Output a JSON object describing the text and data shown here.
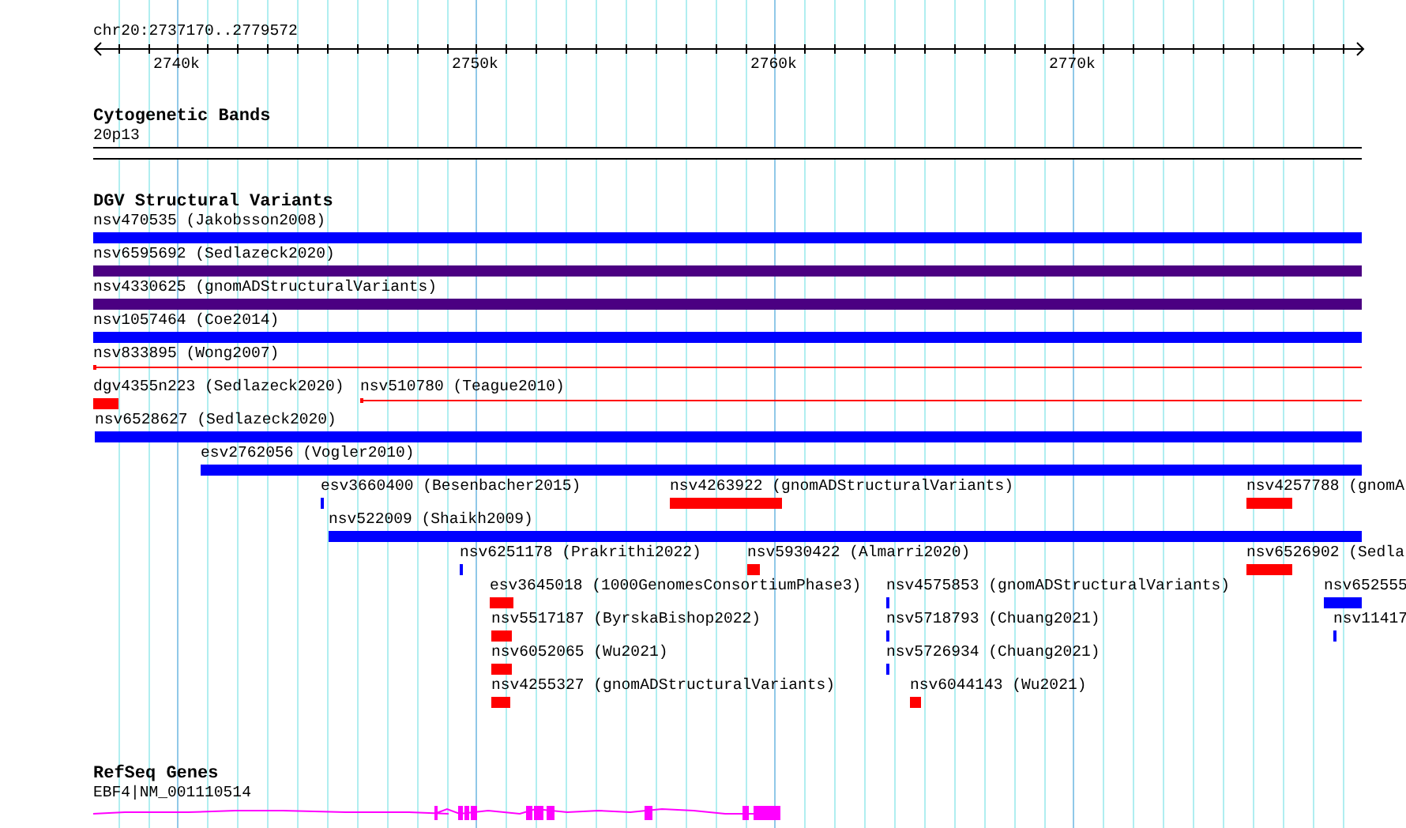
{
  "location": "chr20:2737170..2779572",
  "ruler": {
    "ticks": [
      "2740k",
      "2750k",
      "2760k",
      "2770k"
    ]
  },
  "tracks": [
    {
      "kind": "bands",
      "title": "Cytogenetic Bands",
      "label": "20p13"
    },
    {
      "kind": "variants",
      "title": "DGV Structural Variants",
      "rows": [
        {
          "features": [
            {
              "label": "nsv470535 (Jakobsson2008)",
              "kind": "bar",
              "color": "#0000ff"
            }
          ]
        },
        {
          "features": [
            {
              "label": "nsv6595692 (Sedlazeck2020)",
              "kind": "bar",
              "color": "#4b0082"
            }
          ]
        },
        {
          "features": [
            {
              "label": "nsv4330625 (gnomADStructuralVariants)",
              "kind": "bar",
              "color": "#4b0082"
            }
          ]
        },
        {
          "features": [
            {
              "label": "nsv1057464 (Coe2014)",
              "kind": "bar",
              "color": "#0000ff"
            }
          ]
        },
        {
          "features": [
            {
              "label": "nsv833895 (Wong2007)",
              "kind": "line",
              "color": "#ff0000"
            }
          ]
        },
        {
          "features": [
            {
              "label": "dgv4355n223 (Sedlazeck2020)",
              "kind": "bar",
              "color": "#ff0000"
            },
            {
              "label": "nsv510780 (Teague2010)",
              "kind": "line",
              "color": "#ff0000"
            }
          ]
        },
        {
          "features": [
            {
              "label": "nsv6528627 (Sedlazeck2020)",
              "kind": "bar",
              "color": "#0000ff"
            }
          ]
        },
        {
          "features": [
            {
              "label": "esv2762056 (Vogler2010)",
              "kind": "bar",
              "color": "#0000ff"
            }
          ]
        },
        {
          "features": [
            {
              "label": "esv3660400 (Besenbacher2015)",
              "kind": "bar",
              "color": "#0000ff"
            },
            {
              "label": "nsv4263922 (gnomADStructuralVariants)",
              "kind": "bar",
              "color": "#ff0000"
            },
            {
              "label": "nsv4257788 (gnomA",
              "kind": "bar",
              "color": "#ff0000"
            }
          ]
        },
        {
          "features": [
            {
              "label": "nsv522009 (Shaikh2009)",
              "kind": "bar",
              "color": "#0000ff"
            }
          ]
        },
        {
          "features": [
            {
              "label": "nsv6251178 (Prakrithi2022)",
              "kind": "bar",
              "color": "#0000ff"
            },
            {
              "label": "nsv5930422 (Almarri2020)",
              "kind": "bar",
              "color": "#ff0000"
            },
            {
              "label": "nsv6526902 (Sedla",
              "kind": "bar",
              "color": "#ff0000"
            }
          ]
        },
        {
          "features": [
            {
              "label": "esv3645018 (1000GenomesConsortiumPhase3)",
              "kind": "bar",
              "color": "#ff0000"
            },
            {
              "label": "nsv4575853 (gnomADStructuralVariants)",
              "kind": "bar",
              "color": "#0000ff"
            },
            {
              "label": "nsv652555",
              "kind": "bar",
              "color": "#0000ff"
            }
          ]
        },
        {
          "features": [
            {
              "label": "nsv5517187 (ByrskaBishop2022)",
              "kind": "bar",
              "color": "#ff0000"
            },
            {
              "label": "nsv5718793 (Chuang2021)",
              "kind": "bar",
              "color": "#0000ff"
            },
            {
              "label": "nsv11417",
              "kind": "bar",
              "color": "#0000ff"
            }
          ]
        },
        {
          "features": [
            {
              "label": "nsv6052065 (Wu2021)",
              "kind": "bar",
              "color": "#ff0000"
            },
            {
              "label": "nsv5726934 (Chuang2021)",
              "kind": "bar",
              "color": "#0000ff"
            }
          ]
        },
        {
          "features": [
            {
              "label": "nsv4255327 (gnomADStructuralVariants)",
              "kind": "bar",
              "color": "#ff0000"
            },
            {
              "label": "nsv6044143 (Wu2021)",
              "kind": "bar",
              "color": "#ff0000"
            }
          ]
        }
      ]
    },
    {
      "kind": "genes",
      "title": "RefSeq Genes",
      "label": "EBF4|NM_001110514"
    }
  ]
}
